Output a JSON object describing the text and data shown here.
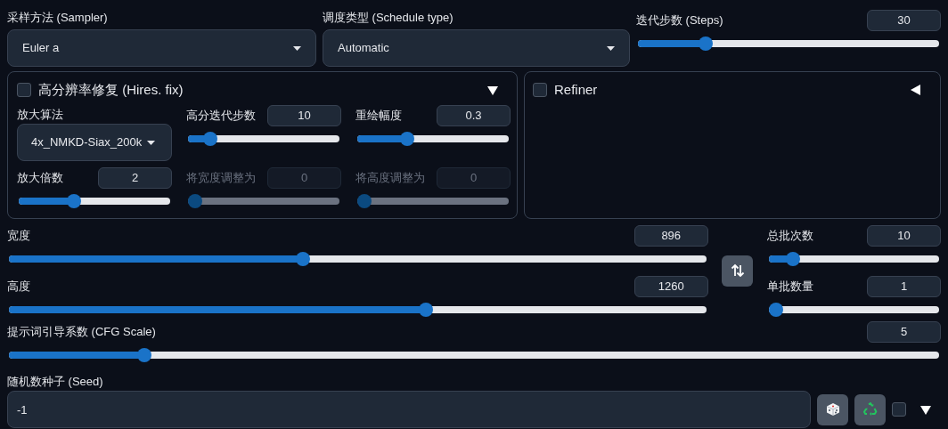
{
  "sampler": {
    "label": "采样方法 (Sampler)",
    "value": "Euler a"
  },
  "schedule_type": {
    "label": "调度类型 (Schedule type)",
    "value": "Automatic"
  },
  "steps": {
    "label": "迭代步数 (Steps)",
    "value": "30",
    "level": 0.21
  },
  "hires_fix": {
    "label": "高分辨率修复 (Hires. fix)",
    "checked": false,
    "expanded": true,
    "upscaler": {
      "label": "放大算法",
      "value": "4x_NMKD-Siax_200k"
    },
    "sliders": [
      {
        "label": "高分迭代步数",
        "value": "10",
        "level": 0.11,
        "disabled": false
      },
      {
        "label": "重绘幅度",
        "value": "0.3",
        "level": 0.31,
        "disabled": false
      },
      {
        "label": "放大倍数",
        "value": "2",
        "level": 0.35,
        "disabled": false
      },
      {
        "label": "将宽度调整为",
        "value": "0",
        "level": 0,
        "disabled": true
      },
      {
        "label": "将高度调整为",
        "value": "0",
        "level": 0,
        "disabled": true
      }
    ]
  },
  "refiner": {
    "label": "Refiner",
    "checked": false,
    "expanded": false
  },
  "width": {
    "label": "宽度",
    "value": "896",
    "level": 0.42
  },
  "height": {
    "label": "高度",
    "value": "1260",
    "level": 0.6
  },
  "batch_count": {
    "label": "总批次数",
    "value": "10",
    "level": 0.11
  },
  "batch_size": {
    "label": "单批数量",
    "value": "1",
    "level": 0
  },
  "cfg_scale": {
    "label": "提示词引导系数 (CFG Scale)",
    "value": "5",
    "level": 0.14
  },
  "seed": {
    "label": "随机数种子 (Seed)",
    "value": "-1",
    "extra_checked": false,
    "extra_expanded": true
  }
}
